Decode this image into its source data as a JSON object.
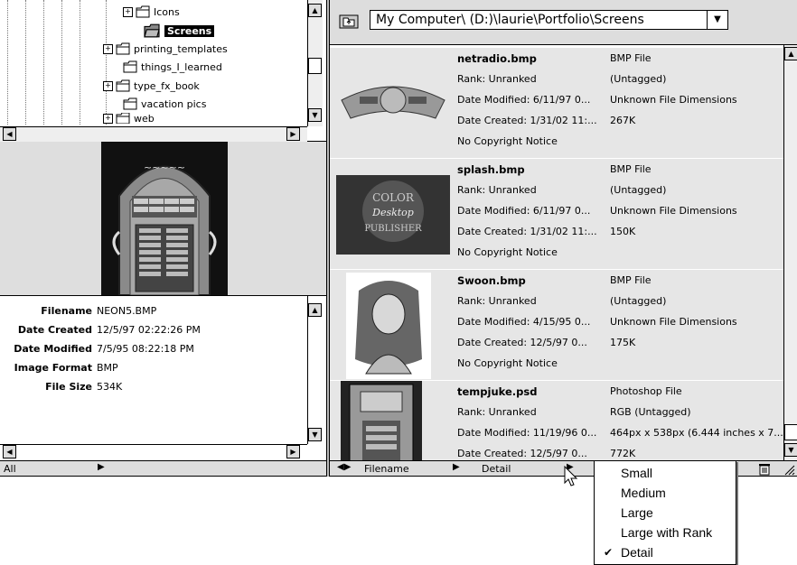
{
  "tree": {
    "items": [
      {
        "label": "Icons",
        "expanded": false
      },
      {
        "label": "Screens",
        "selected": true
      },
      {
        "label": "printing_templates",
        "expanded": false
      },
      {
        "label": "things_I_learned"
      },
      {
        "label": "type_fx_book",
        "expanded": false
      },
      {
        "label": "vacation pics"
      },
      {
        "label": "web",
        "expanded": false
      }
    ]
  },
  "metadata": [
    {
      "key": "Filename",
      "value": "NEON5.BMP"
    },
    {
      "key": "Date Created",
      "value": "12/5/97 02:22:26 PM"
    },
    {
      "key": "Date Modified",
      "value": "7/5/95 08:22:18 PM"
    },
    {
      "key": "Image Format",
      "value": "BMP"
    },
    {
      "key": "File Size",
      "value": "534K"
    }
  ],
  "left_status": {
    "filter": "All"
  },
  "path": {
    "value": "My Computer\\ (D:)\\laurie\\Portfolio\\Screens"
  },
  "files": [
    {
      "name": "netradio.bmp",
      "rank": "Rank: Unranked",
      "modified": "Date Modified: 6/11/97 0...",
      "created": "Date Created: 1/31/02 11:...",
      "copyright": "No Copyright Notice",
      "type": "BMP File",
      "tag": "(Untagged)",
      "dims": "Unknown File Dimensions",
      "size": "267K"
    },
    {
      "name": "splash.bmp",
      "rank": "Rank: Unranked",
      "modified": "Date Modified: 6/11/97 0...",
      "created": "Date Created: 1/31/02 11:...",
      "copyright": "No Copyright Notice",
      "type": "BMP File",
      "tag": "(Untagged)",
      "dims": "Unknown File Dimensions",
      "size": "150K"
    },
    {
      "name": "Swoon.bmp",
      "rank": "Rank: Unranked",
      "modified": "Date Modified: 4/15/95 0...",
      "created": "Date Created: 12/5/97 0...",
      "copyright": "No Copyright Notice",
      "type": "BMP File",
      "tag": "(Untagged)",
      "dims": "Unknown File Dimensions",
      "size": "175K"
    },
    {
      "name": "tempjuke.psd",
      "rank": "Rank: Unranked",
      "modified": "Date Modified: 11/19/96 0...",
      "created": "Date Created: 12/5/97 0...",
      "copyright": "",
      "type": "Photoshop File",
      "tag": "RGB (Untagged)",
      "dims": "464px x 538px (6.444 inches x 7...",
      "size": "772K"
    }
  ],
  "right_status": {
    "sort": "Filename",
    "view": "Detail"
  },
  "view_menu": {
    "items": [
      {
        "label": "Small",
        "checked": false
      },
      {
        "label": "Medium",
        "checked": false
      },
      {
        "label": "Large",
        "checked": false
      },
      {
        "label": "Large with Rank",
        "checked": false
      },
      {
        "label": "Detail",
        "checked": true
      }
    ]
  },
  "icons": [
    "folder-icon",
    "expand-icon",
    "up-folder-icon",
    "arrow-icon",
    "trash-icon",
    "checkmark-icon",
    "cursor-icon"
  ]
}
